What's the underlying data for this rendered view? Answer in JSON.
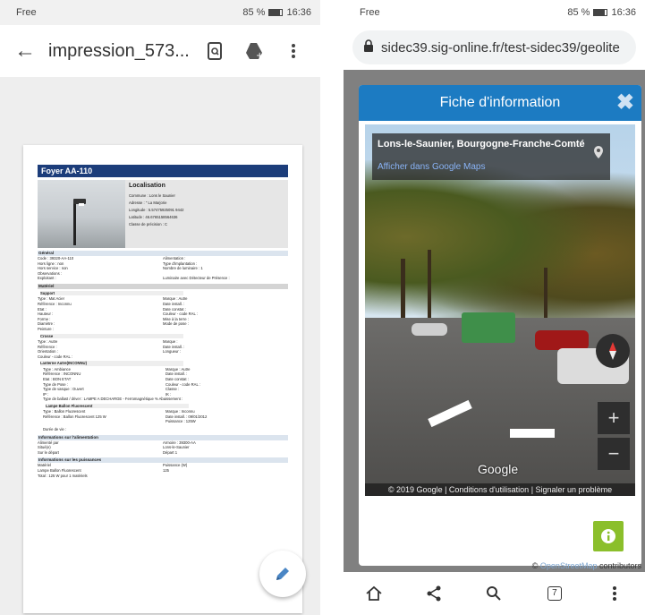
{
  "left": {
    "status": {
      "carrier": "Free",
      "right": "85 %",
      "time": "16:36"
    },
    "appbar": {
      "title": "impression_573..."
    },
    "doc": {
      "header": "Foyer AA-110",
      "localisation": {
        "title": "Localisation",
        "commune": "Commune : Lons le Saunier",
        "adresse": "Adresse : \" La Marjorie",
        "longitude": "Longitude : 5.57475925091 9442",
        "latitude": "Latitude : 46.6765158564636",
        "precision": "Classe de précision : C"
      },
      "general": {
        "title": "Général",
        "rows": [
          [
            "Code : 39320-AA-110",
            "Alimentation :"
          ],
          [
            "Hors ligne : non",
            "Type d'implantation :"
          ],
          [
            "Hors service : non",
            "Nombre de luminaire : 1"
          ],
          [
            "Observations :",
            ""
          ],
          [
            "Exploitant :",
            "Luminaire avec Détecteur de Présence :"
          ]
        ]
      },
      "materiel": {
        "title": "Matériel",
        "support_title": "Support",
        "support_rows": [
          [
            "Type : Mat Acier",
            "Marque : Autre"
          ],
          [
            "Référence : Inconnu",
            "Date install. :"
          ],
          [
            "Etat :",
            "Date constat :"
          ],
          [
            "Hauteur :",
            "Couleur - code RAL :"
          ],
          [
            "Forme :",
            "Mise à la terre :"
          ],
          [
            "Diamètre :",
            "Mode de pose :"
          ],
          [
            "Peinture :",
            ""
          ]
        ],
        "crosse_title": "Crosse",
        "crosse_rows": [
          [
            "Type : Autre",
            "Marque :"
          ],
          [
            "Référence :",
            "Date install. :"
          ],
          [
            "Orientation :",
            "Longueur :"
          ],
          [
            "Couleur - code RAL :",
            ""
          ]
        ],
        "lanterne_title": "Lanterne Autre(INCONNU)",
        "lanterne_rows": [
          [
            "Type : Ambiance",
            "Marque : Autre"
          ],
          [
            "Référence : INCONNU",
            "Date install. :"
          ],
          [
            "Etat : BON ETAT",
            "Date constat :"
          ],
          [
            "Type de Pose :",
            "Couleur - code RAL :"
          ],
          [
            "Type de vasque : Ouvert",
            "Classe :"
          ],
          [
            "IP :",
            "IK :"
          ]
        ],
        "ballast": "Type de ballast / driver : LAMPE A DECHARGE - Ferromagnétique % Abaissement :",
        "lampe_title": "Lampe Ballon Fluorescent",
        "lampe_rows": [
          [
            "Type : Ballon Fluorescent",
            "Marque : Inconnu"
          ],
          [
            "Référence : Ballon Fluorescent 125 W",
            "Date install. : 09/01/2012"
          ],
          [
            "",
            "Puissance : 125W"
          ]
        ],
        "duree": "Durée de vie :"
      },
      "alimentation": {
        "title": "Informations sur l'alimentation",
        "rows": [
          [
            "Alimenté par",
            "Armoire : 39300-AA"
          ],
          [
            "Situé(e)",
            "Lons-le-Saunier"
          ],
          [
            "Sur le départ",
            "Départ 1"
          ]
        ]
      },
      "puissances": {
        "title": "Informations sur les puissances",
        "rows": [
          [
            "Matériel",
            "Puissance (W)"
          ],
          [
            "Lampe Ballon Fluorescent",
            "125"
          ],
          [
            "Total : 125 W pour 1 matériels",
            ""
          ]
        ]
      }
    }
  },
  "right": {
    "status": {
      "carrier": "Free",
      "right": "85 %",
      "time": "16:36"
    },
    "url": "sidec39.sig-online.fr/test-sidec39/geolite",
    "modal": {
      "title": "Fiche d'information",
      "place": "Lons-le-Saunier, Bourgogne-Franche-Comté",
      "gmaps_link": "Afficher dans Google Maps",
      "google_logo": "Google",
      "footer": "© 2019 Google | Conditions d'utilisation | Signaler un problème"
    },
    "osm": {
      "prefix": "© ",
      "link": "OpenStreetMap",
      "suffix": " contributors"
    },
    "tab_count": "7"
  },
  "colors": {
    "header_blue": "#1c3d7a",
    "modal_blue": "#1c7bc2",
    "info_green": "#8bbf2b"
  }
}
